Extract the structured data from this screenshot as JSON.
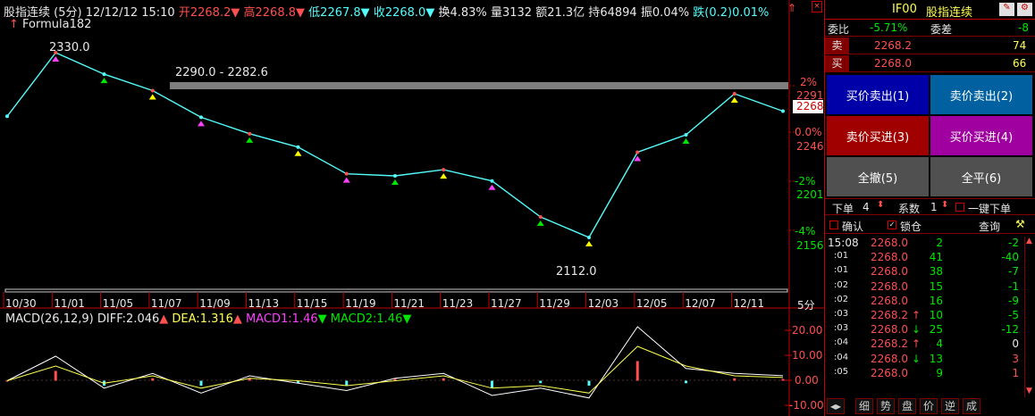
{
  "header": {
    "title": "股指连续",
    "period": "(5分)",
    "datetime": "12/12/12 15:10",
    "open_label": "开",
    "open": "2268.2",
    "high_label": "高",
    "high": "2268.8",
    "low_label": "低",
    "low": "2267.8",
    "close_label": "收",
    "close": "2268.0",
    "turnover_label": "换",
    "turnover": "4.83%",
    "volume_label": "量",
    "volume": "3132",
    "amount_label": "额",
    "amount": "21.3亿",
    "oi_label": "持",
    "oi": "64894",
    "amp_label": "振",
    "amp": "0.04%",
    "chg_label": "跌",
    "chg": "(0.2)0.01%"
  },
  "formula": "Formula182",
  "annotations": {
    "peak": "2330.0",
    "trough": "2112.0",
    "band": "2290.0 - 2282.6"
  },
  "price_axis": {
    "labels": [
      "2%",
      "2291",
      "0.0%",
      "2246",
      "-2%",
      "2201",
      "-4%",
      "2156"
    ],
    "current_tag": "2268"
  },
  "macd": {
    "label": "MACD(26,12,9)",
    "diff_label": "DIFF:",
    "diff": "2.046",
    "dea_label": "DEA:",
    "dea": "1.316",
    "macd1_label": "MACD1:",
    "macd1": "1.46",
    "macd2_label": "MACD2:",
    "macd2": "1.46",
    "axis": [
      "20.00",
      "10.00",
      "0.00",
      "-10.00"
    ]
  },
  "time_axis": {
    "labels": [
      "10/30",
      "11/01",
      "11/05",
      "11/07",
      "11/09",
      "11/13",
      "11/15",
      "11/19",
      "11/21",
      "11/23",
      "11/27",
      "11/29",
      "12/03",
      "12/05",
      "12/07",
      "12/11"
    ],
    "unit": "5分"
  },
  "chart_data": {
    "type": "line",
    "title": "",
    "x": [
      "10/30",
      "11/01",
      "11/05",
      "11/07",
      "11/09",
      "11/13",
      "11/15",
      "11/19",
      "11/21",
      "11/23",
      "11/27",
      "11/29",
      "12/03",
      "12/05",
      "12/07",
      "12/11",
      "12/12"
    ],
    "series": [
      {
        "name": "",
        "values": [
          2263,
          2325,
          2304,
          2288,
          2262,
          2246,
          2233,
          2207,
          2205,
          2211,
          2200,
          2165,
          2145,
          2228,
          2245,
          2285,
          2268
        ]
      },
      {
        "name": "DIFF",
        "values": [
          0,
          10,
          -3,
          3,
          -5,
          2,
          -1,
          -4,
          1,
          3,
          -6,
          -3,
          -7,
          22,
          5,
          3,
          2.046
        ]
      },
      {
        "name": "DEA",
        "values": [
          0,
          6,
          -1,
          2,
          -3,
          1,
          0,
          -2,
          0,
          2,
          -3,
          -2,
          -5,
          14,
          6,
          2,
          1.316
        ]
      }
    ],
    "ylim": [
      2105,
      2338
    ],
    "macd_ylim": [
      -10,
      22
    ]
  },
  "right_panel": {
    "code": "IF00",
    "name": "股指连续",
    "weibi_label": "委比",
    "weibi": "-5.71%",
    "weicha_label": "委差",
    "weicha": "-8",
    "sell_label": "卖",
    "sell_price": "2268.2",
    "sell_vol": "74",
    "buy_label": "买",
    "buy_price": "2268.0",
    "buy_vol": "66",
    "buttons": [
      "买价卖出(1)",
      "卖价卖出(2)",
      "卖价买进(3)",
      "买价买进(4)",
      "全撤(5)",
      "全平(6)"
    ],
    "order_label": "下单",
    "order_qty": "4",
    "factor_label": "系数",
    "factor": "1",
    "one_key_label": "一键下单",
    "confirm_label": "确认",
    "lock_label": "锁仓",
    "query_label": "查询",
    "ticks": [
      {
        "time": "15:08",
        "price": "2268.0",
        "arrow": "",
        "vol": "2",
        "chg": "-2"
      },
      {
        "time": ":01",
        "price": "2268.0",
        "arrow": "",
        "vol": "41",
        "chg": "-40"
      },
      {
        "time": ":01",
        "price": "2268.0",
        "arrow": "",
        "vol": "38",
        "chg": "-7"
      },
      {
        "time": ":02",
        "price": "2268.0",
        "arrow": "",
        "vol": "15",
        "chg": "-1"
      },
      {
        "time": ":02",
        "price": "2268.0",
        "arrow": "",
        "vol": "16",
        "chg": "-9"
      },
      {
        "time": ":03",
        "price": "2268.2",
        "arrow": "↑",
        "vol": "10",
        "chg": "-5"
      },
      {
        "time": ":03",
        "price": "2268.0",
        "arrow": "↓",
        "vol": "25",
        "chg": "-12"
      },
      {
        "time": ":04",
        "price": "2268.2",
        "arrow": "↑",
        "vol": "4",
        "chg": "0"
      },
      {
        "time": ":04",
        "price": "2268.0",
        "arrow": "↓",
        "vol": "13",
        "chg": "3"
      },
      {
        "time": ":05",
        "price": "2268.0",
        "arrow": "",
        "vol": "9",
        "chg": "1"
      }
    ],
    "tabs": [
      "细",
      "势",
      "盘",
      "价",
      "逆",
      "成"
    ]
  }
}
